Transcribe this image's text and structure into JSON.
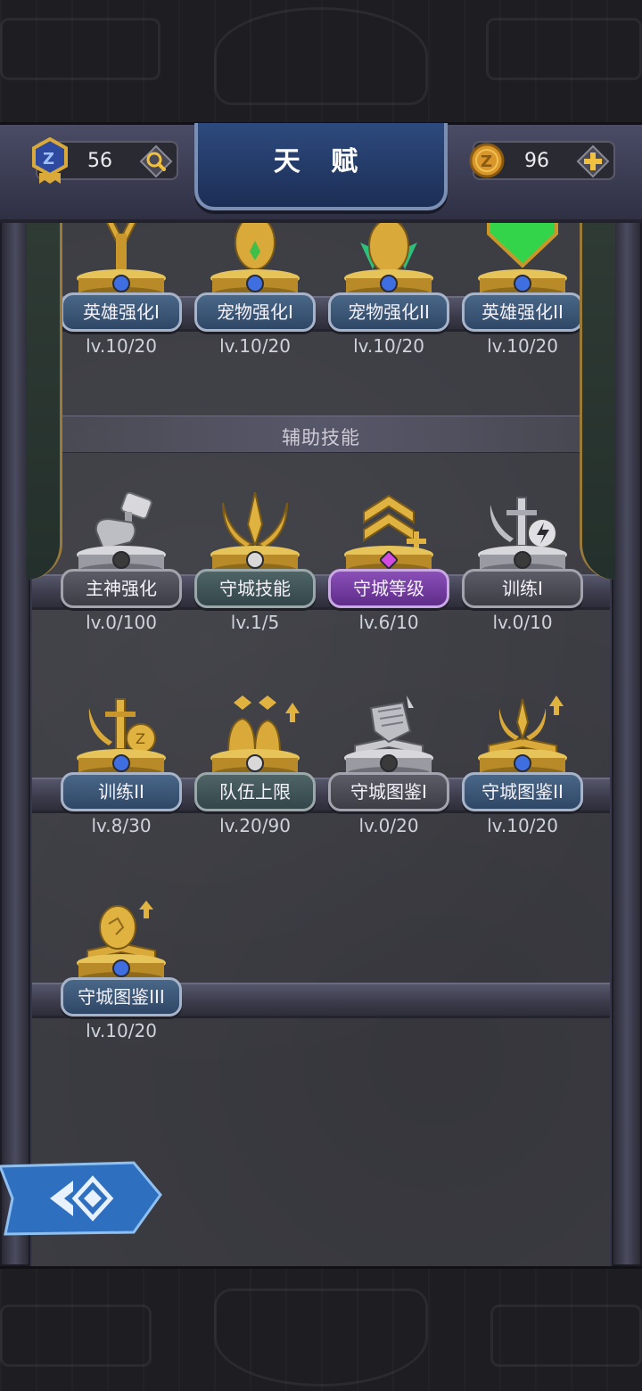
{
  "header": {
    "title": "天 赋",
    "gem_count": "56",
    "coin_count": "96"
  },
  "section_header": "辅助技能",
  "top_row": [
    {
      "name": "英雄强化I",
      "level": "lv.10/20",
      "plate": "blue",
      "gem": "#3f6ee0",
      "icon": "hero-upgrade-icon"
    },
    {
      "name": "宠物强化I",
      "level": "lv.10/20",
      "plate": "blue",
      "gem": "#3f6ee0",
      "icon": "pet-egg-icon"
    },
    {
      "name": "宠物强化II",
      "level": "lv.10/20",
      "plate": "blue",
      "gem": "#3f6ee0",
      "icon": "pet-egg-icon"
    },
    {
      "name": "英雄强化II",
      "level": "lv.10/20",
      "plate": "blue",
      "gem": "#3f6ee0",
      "icon": "hero-upgrade-icon"
    }
  ],
  "row2": [
    {
      "name": "主神强化",
      "level": "lv.0/100",
      "plate": "grey",
      "gem": "#3a3a3a",
      "icon": "hammer-fist-icon"
    },
    {
      "name": "守城技能",
      "level": "lv.1/5",
      "plate": "teal",
      "gem": "#d8d8d8",
      "icon": "trident-icon"
    },
    {
      "name": "守城等级",
      "level": "lv.6/10",
      "plate": "purple",
      "gem": "#d24be0",
      "icon": "rank-chevron-plus-icon"
    },
    {
      "name": "训练I",
      "level": "lv.0/10",
      "plate": "grey",
      "gem": "#3a3a3a",
      "icon": "sword-lightning-icon"
    }
  ],
  "row3": [
    {
      "name": "训练II",
      "level": "lv.8/30",
      "plate": "blue",
      "gem": "#3f6ee0",
      "icon": "sword-coin-icon"
    },
    {
      "name": "队伍上限",
      "level": "lv.20/90",
      "plate": "teal",
      "gem": "#d8d8d8",
      "icon": "team-limit-icon"
    },
    {
      "name": "守城图鉴I",
      "level": "lv.0/20",
      "plate": "grey",
      "gem": "#3a3a3a",
      "icon": "codex-shield-icon"
    },
    {
      "name": "守城图鉴II",
      "level": "lv.10/20",
      "plate": "blue",
      "gem": "#3f6ee0",
      "icon": "codex-trident-icon"
    }
  ],
  "row4": [
    {
      "name": "守城图鉴III",
      "level": "lv.10/20",
      "plate": "blue",
      "gem": "#3f6ee0",
      "icon": "codex-egg-icon"
    }
  ],
  "colors": {
    "gold": "#d9a93a",
    "silver": "#c8c8cc",
    "accent_blue": "#2d4a7e"
  }
}
